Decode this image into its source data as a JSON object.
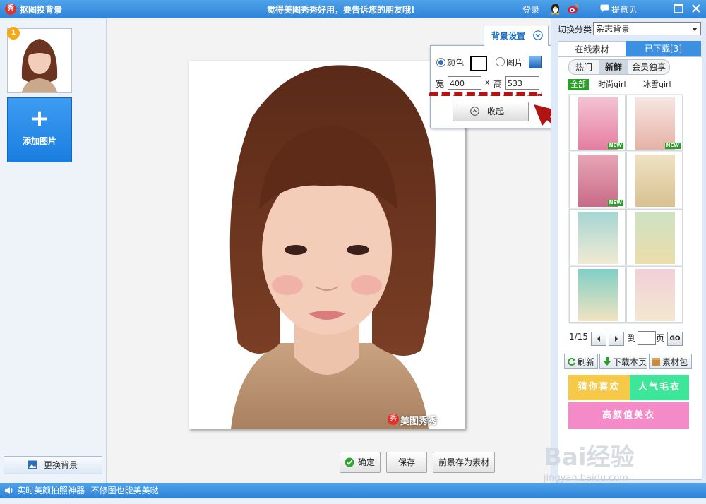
{
  "titlebar": {
    "logo_char": "秀",
    "title": "抠图换背景",
    "slogan": "觉得美图秀秀好用，要告诉您的朋友哦!",
    "login": "登录",
    "feedback": "提意见"
  },
  "left_panel": {
    "thumb_badge": "1",
    "add_image_plus": "+",
    "add_image": "添加图片",
    "change_bg": "更换背景"
  },
  "canvas": {
    "watermark_logo": "秀",
    "watermark_text": "美图秀秀"
  },
  "bg_settings": {
    "title": "背景设置",
    "color_option": "颜色",
    "image_option": "图片",
    "width_label": "宽",
    "width_value": "400",
    "times": "x",
    "height_label": "高",
    "height_value": "533",
    "collapse": "收起",
    "selected": "颜色"
  },
  "actions": {
    "confirm": "确定",
    "save": "保存",
    "save_fg": "前景存为素材"
  },
  "right_panel": {
    "category_label": "切换分类",
    "category_value": "杂志背景",
    "tab_online": "在线素材",
    "tab_downloaded": "已下载[3]",
    "subtabs": [
      "热门",
      "新鲜",
      "会员独享"
    ],
    "subtab_active": "新鲜",
    "filters": [
      "全部",
      "时尚girl",
      "冰雪girl"
    ],
    "filter_active": "全部",
    "new_tag": "NEW",
    "pager": {
      "current": "1/15",
      "goto_label": "到",
      "page_label": "页",
      "go": "GO"
    },
    "buttons": {
      "refresh": "刷新",
      "download_page": "下载本页",
      "package": "素材包"
    },
    "banners": [
      "猜你喜欢",
      "人气毛衣",
      "高颜值美衣"
    ]
  },
  "status": {
    "text": "实时美颜拍照神器--不修图也能美美哒"
  },
  "site_watermark": {
    "main": "Bai经验",
    "url": "jingyan.baidu.com"
  },
  "colors": {
    "accent_blue": "#2f82d6",
    "arrow_red": "#b01414",
    "banner_yellow": "#f7c948",
    "banner_green": "#3ee69a",
    "banner_pink": "#f58ac8"
  }
}
